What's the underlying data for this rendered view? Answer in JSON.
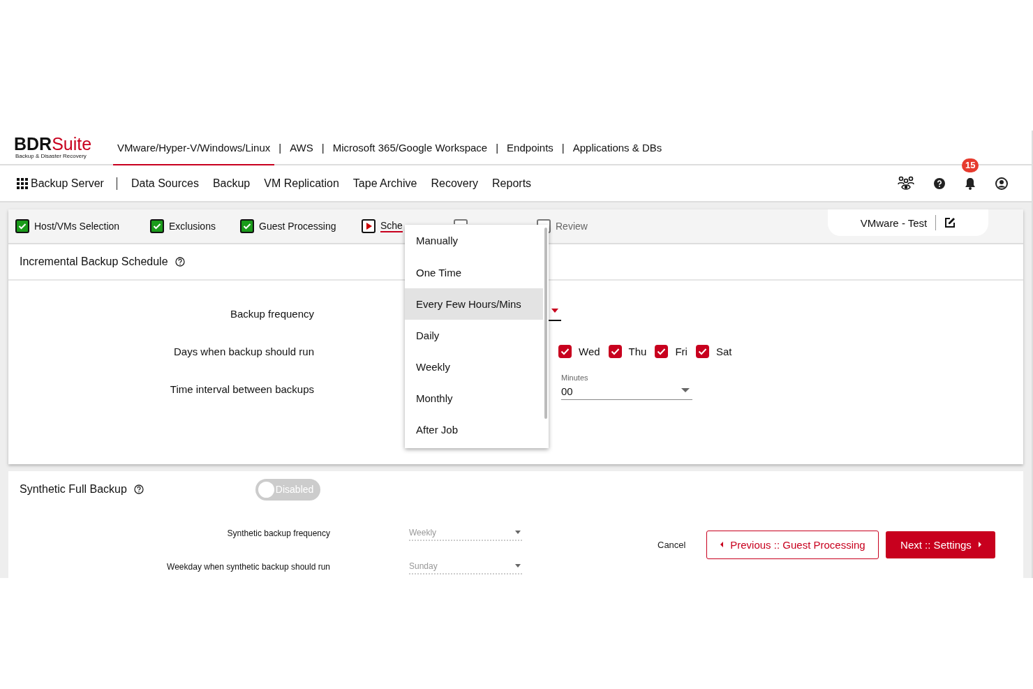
{
  "brand": {
    "name": "BDR",
    "name_accent": "Suite",
    "tagline": "Backup & Disaster Recovery"
  },
  "product_tabs": [
    {
      "label": "VMware/Hyper-V/Windows/Linux",
      "selected": true
    },
    {
      "separator": "|",
      "label": "AWS",
      "selected": false
    },
    {
      "separator": "|",
      "label": "Microsoft 365/Google Workspace",
      "selected": false
    },
    {
      "separator": "|",
      "label": "Endpoints",
      "selected": false
    },
    {
      "separator": "|",
      "label": "Applications & DBs",
      "selected": false
    }
  ],
  "nav": {
    "home": "Backup Server",
    "items": [
      "Data Sources",
      "Backup",
      "VM Replication",
      "Tape Archive",
      "Recovery",
      "Reports"
    ],
    "notification_count": "15"
  },
  "wizard_steps": [
    {
      "label": "Host/VMs Selection",
      "completed": true,
      "selected": false
    },
    {
      "label": "Exclusions",
      "completed": true,
      "selected": false
    },
    {
      "label": "Guest Processing",
      "completed": true,
      "selected": false
    },
    {
      "label": "Sche",
      "completed": false,
      "selected": true
    },
    {
      "completed": false,
      "selected": false
    },
    {
      "label": "Review",
      "completed": false,
      "selected": false
    }
  ],
  "job_name": "VMware - Test",
  "incremental": {
    "title": "Incremental Backup Schedule",
    "frequency_label": "Backup frequency",
    "days_label": "Days when backup should run",
    "days": [
      {
        "label": "Wed",
        "checked": true
      },
      {
        "label": "Thu",
        "checked": true
      },
      {
        "label": "Fri",
        "checked": true
      },
      {
        "label": "Sat",
        "checked": true
      }
    ],
    "interval_label": "Time interval between backups",
    "minutes_label": "Minutes",
    "minutes_value": "00"
  },
  "frequency_menu": [
    {
      "label": "Manually",
      "selected": false
    },
    {
      "label": "One Time",
      "selected": false
    },
    {
      "label": "Every Few Hours/Mins",
      "selected": true
    },
    {
      "label": "Daily",
      "selected": false
    },
    {
      "label": "Weekly",
      "selected": false
    },
    {
      "label": "Monthly",
      "selected": false
    },
    {
      "label": "After Job",
      "selected": false
    }
  ],
  "synthetic": {
    "title": "Synthetic Full Backup",
    "toggle": {
      "label": "Disabled",
      "on": false
    },
    "fields": [
      {
        "label": "Synthetic backup frequency",
        "value": "Weekly"
      },
      {
        "label": "Weekday when synthetic backup should run",
        "value": "Sunday"
      }
    ]
  },
  "buttons": {
    "cancel": "Cancel",
    "previous": "Previous :: Guest Processing",
    "next": "Next :: Settings"
  }
}
